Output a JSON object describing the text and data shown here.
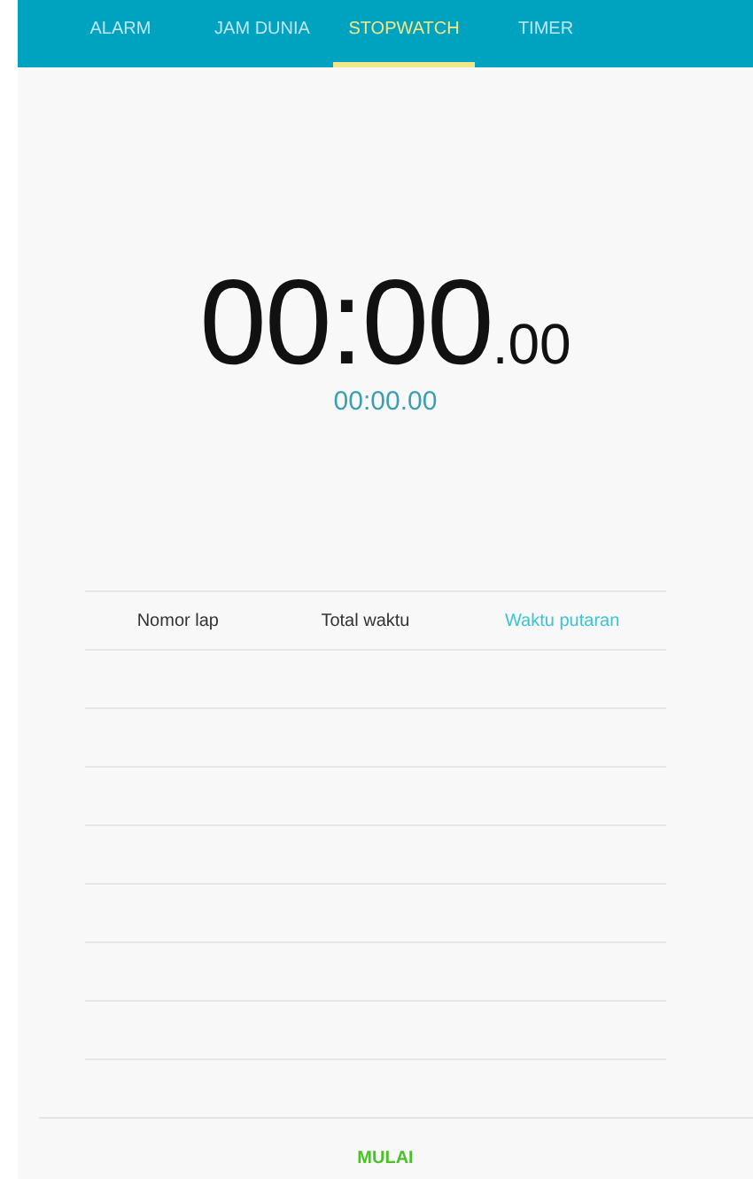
{
  "tabs": [
    {
      "label": "ALARM",
      "selected": false
    },
    {
      "label": "JAM DUNIA",
      "selected": false
    },
    {
      "label": "STOPWATCH",
      "selected": true
    },
    {
      "label": "TIMER",
      "selected": false
    }
  ],
  "stopwatch": {
    "time": "00:00",
    "fraction": ".00",
    "lap_time": "00:00.00"
  },
  "lap_table": {
    "columns": [
      {
        "label": "Nomor lap",
        "selected": false
      },
      {
        "label": "Total waktu",
        "selected": false
      },
      {
        "label": "Waktu putaran",
        "selected": true
      }
    ]
  },
  "start_button": "MULAI"
}
